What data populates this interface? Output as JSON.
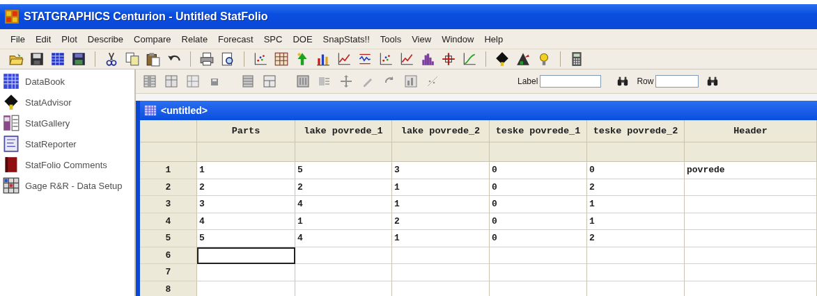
{
  "window": {
    "title": "STATGRAPHICS Centurion - Untitled StatFolio"
  },
  "menu": [
    "File",
    "Edit",
    "Plot",
    "Describe",
    "Compare",
    "Relate",
    "Forecast",
    "SPC",
    "DOE",
    "SnapStats!!",
    "Tools",
    "View",
    "Window",
    "Help"
  ],
  "sidebar": {
    "items": [
      {
        "label": "DataBook"
      },
      {
        "label": "StatAdvisor"
      },
      {
        "label": "StatGallery"
      },
      {
        "label": "StatReporter"
      },
      {
        "label": "StatFolio Comments"
      },
      {
        "label": "Gage R&R - Data Setup"
      }
    ]
  },
  "data_toolbar": {
    "label_field": {
      "label": "Label"
    },
    "row_field": {
      "label": "Row"
    }
  },
  "datasheet": {
    "title": "<untitled>",
    "columns": [
      "Parts",
      "lake povrede_1",
      "lake povrede_2",
      "teske povrede_1",
      "teske povrede_2",
      "Header"
    ],
    "rows": [
      {
        "number": "1",
        "cells": [
          "1",
          "5",
          "3",
          "0",
          "0",
          "povrede"
        ],
        "cursor": false
      },
      {
        "number": "2",
        "cells": [
          "2",
          "2",
          "1",
          "0",
          "2"
        ],
        "cursor": false
      },
      {
        "number": "3",
        "cells": [
          "3",
          "4",
          "1",
          "0",
          "1"
        ],
        "cursor": false
      },
      {
        "number": "4",
        "cells": [
          "4",
          "1",
          "2",
          "0",
          "1"
        ],
        "cursor": false
      },
      {
        "number": "5",
        "cells": [
          "5",
          "4",
          "1",
          "0",
          "2"
        ],
        "cursor": false
      },
      {
        "number": "6",
        "cursor": true
      },
      {
        "number": "7",
        "cursor": false
      },
      {
        "number": "8",
        "cursor": false
      }
    ]
  }
}
